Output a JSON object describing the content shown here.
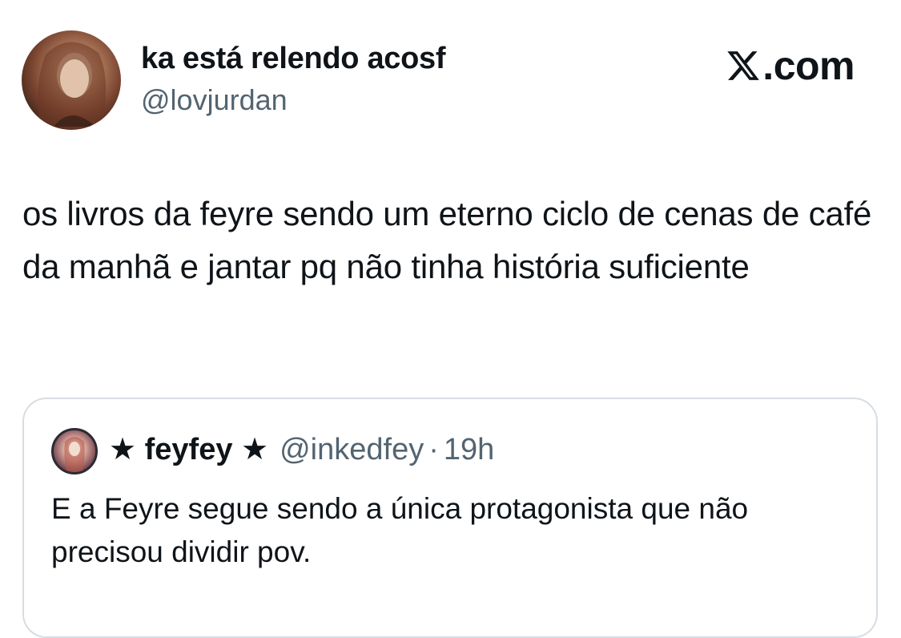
{
  "author": {
    "display_name": "ka está relendo acosf",
    "handle": "@lovjurdan",
    "avatar_icon": "profile-photo"
  },
  "brand": {
    "label": ".com",
    "logo_icon": "x-logo-icon"
  },
  "tweet": {
    "text": "os livros da feyre sendo um eterno ciclo de cenas de café da manhã e jantar pq não tinha história suficiente"
  },
  "quoted_tweet": {
    "display_name": "★ feyfey ★",
    "handle": "@inkedfey",
    "separator": "·",
    "time": "19h",
    "text": "E a Feyre segue sendo a única protagonista que não precisou dividir pov.",
    "avatar_icon": "profile-photo"
  },
  "colors": {
    "text_primary": "#0f1419",
    "text_secondary": "#536471",
    "border": "#d7dde2",
    "background": "#ffffff"
  }
}
